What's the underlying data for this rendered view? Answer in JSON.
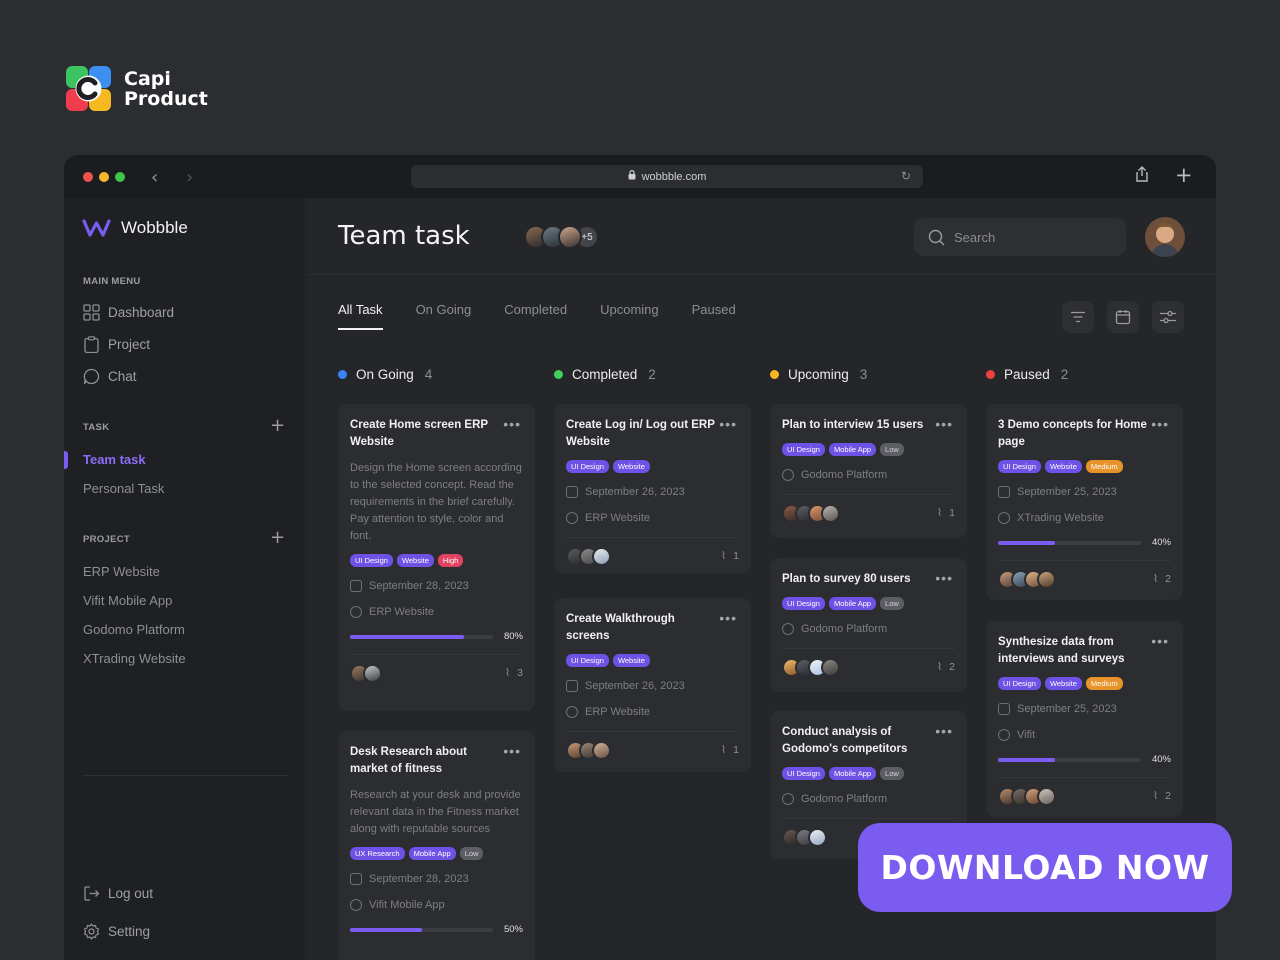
{
  "brand": {
    "line1": "Capi",
    "line2": "Product"
  },
  "browser": {
    "url": "wobbble.com"
  },
  "sidebar": {
    "app_name": "Wobbble",
    "main_menu_label": "MAIN MENU",
    "main_menu": [
      "Dashboard",
      "Project",
      "Chat"
    ],
    "task_label": "TASK",
    "task_items": [
      "Team task",
      "Personal Task"
    ],
    "project_label": "PROJECT",
    "projects": [
      "ERP Website",
      "Vifit Mobile App",
      "Godomo Platform",
      "XTrading Website"
    ],
    "logout": "Log out",
    "setting": "Setting"
  },
  "header": {
    "title": "Team task",
    "members_more": "+5",
    "search_placeholder": "Search"
  },
  "tabs": [
    "All Task",
    "On Going",
    "Completed",
    "Upcoming",
    "Paused"
  ],
  "columns": [
    {
      "name": "On Going",
      "count": "4",
      "color": "#3b82f6"
    },
    {
      "name": "Completed",
      "count": "2",
      "color": "#3fcf5a"
    },
    {
      "name": "Upcoming",
      "count": "3",
      "color": "#f5b81e"
    },
    {
      "name": "Paused",
      "count": "2",
      "color": "#ee4040"
    }
  ],
  "cards": {
    "ongoing1": {
      "title": "Create Home screen ERP Website",
      "desc": "Design the Home screen according to the selected concept. Read the requirements in the brief carefully. Pay attention to style, color and font.",
      "tags": [
        "UI Design",
        "Website",
        "High"
      ],
      "date": "September 28, 2023",
      "project": "ERP Website",
      "progress": "80%",
      "progress_value": 0.8,
      "attachments": "3"
    },
    "ongoing2": {
      "title": "Desk Research about market of fitness",
      "desc": "Research at your desk and provide relevant data in the Fitness market along with reputable sources",
      "tags": [
        "UX Research",
        "Mobile App",
        "Low"
      ],
      "date": "September 28, 2023",
      "project": "Vifit Mobile App",
      "progress": "50%",
      "progress_value": 0.5
    },
    "completed1": {
      "title": "Create Log in/ Log out ERP Website",
      "tags": [
        "UI Design",
        "Website"
      ],
      "date": "September 26, 2023",
      "project": "ERP Website",
      "attachments": "1"
    },
    "completed2": {
      "title": "Create Walkthrough screens",
      "tags": [
        "UI Design",
        "Website"
      ],
      "date": "September 26, 2023",
      "project": "ERP Website",
      "attachments": "1"
    },
    "upcoming1": {
      "title": "Plan to interview 15 users",
      "tags": [
        "UI Design",
        "Mobile App",
        "Low"
      ],
      "project": "Godomo Platform",
      "attachments": "1"
    },
    "upcoming2": {
      "title": "Plan to survey 80 users",
      "tags": [
        "UI Design",
        "Mobile App",
        "Low"
      ],
      "project": "Godomo Platform",
      "attachments": "2"
    },
    "upcoming3": {
      "title": "Conduct analysis of Godomo's competitors",
      "tags": [
        "UI Design",
        "Mobile App",
        "Low"
      ],
      "project": "Godomo Platform"
    },
    "paused1": {
      "title": "3 Demo concepts for Home page",
      "tags": [
        "UI Design",
        "Website",
        "Medium"
      ],
      "date": "September 25, 2023",
      "project": "XTrading Website",
      "progress": "40%",
      "progress_value": 0.4,
      "attachments": "2"
    },
    "paused2": {
      "title": "Synthesize data from interviews and surveys",
      "tags": [
        "UI Design",
        "Website",
        "Medium"
      ],
      "date": "September 25, 2023",
      "project": "Vifit",
      "progress": "40%",
      "progress_value": 0.4,
      "attachments": "2"
    }
  },
  "cta": "DOWNLOAD NOW"
}
